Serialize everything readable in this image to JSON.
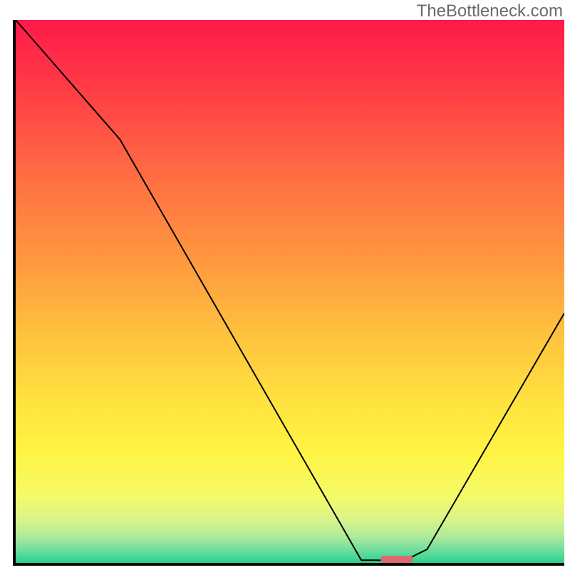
{
  "watermark": "TheBottleneck.com",
  "chart_data": {
    "type": "line",
    "title": "",
    "xlabel": "",
    "ylabel": "",
    "xlim": [
      0,
      100
    ],
    "ylim": [
      0,
      100
    ],
    "grid": false,
    "legend": false,
    "series": [
      {
        "name": "bottleneck-curve",
        "x": [
          0,
          19,
          63,
          71,
          75,
          100
        ],
        "y": [
          100,
          78,
          0.5,
          0.5,
          2.5,
          46
        ]
      }
    ],
    "marker": {
      "name": "optimal-marker",
      "x_start": 66.5,
      "x_end": 72.5,
      "y": 0.6,
      "color": "#db6a6e"
    },
    "gradient_stops": [
      {
        "pos": 0,
        "color": "#ff1a49"
      },
      {
        "pos": 12,
        "color": "#ff3a46"
      },
      {
        "pos": 30,
        "color": "#ff7143"
      },
      {
        "pos": 45,
        "color": "#ff9a3f"
      },
      {
        "pos": 58,
        "color": "#ffc23e"
      },
      {
        "pos": 70,
        "color": "#ffe23f"
      },
      {
        "pos": 80,
        "color": "#fff544"
      },
      {
        "pos": 88,
        "color": "#f4fa69"
      },
      {
        "pos": 92,
        "color": "#d9f48a"
      },
      {
        "pos": 95,
        "color": "#b0eb99"
      },
      {
        "pos": 97,
        "color": "#7fe19f"
      },
      {
        "pos": 99,
        "color": "#47d796"
      },
      {
        "pos": 100,
        "color": "#29cf8a"
      }
    ]
  }
}
